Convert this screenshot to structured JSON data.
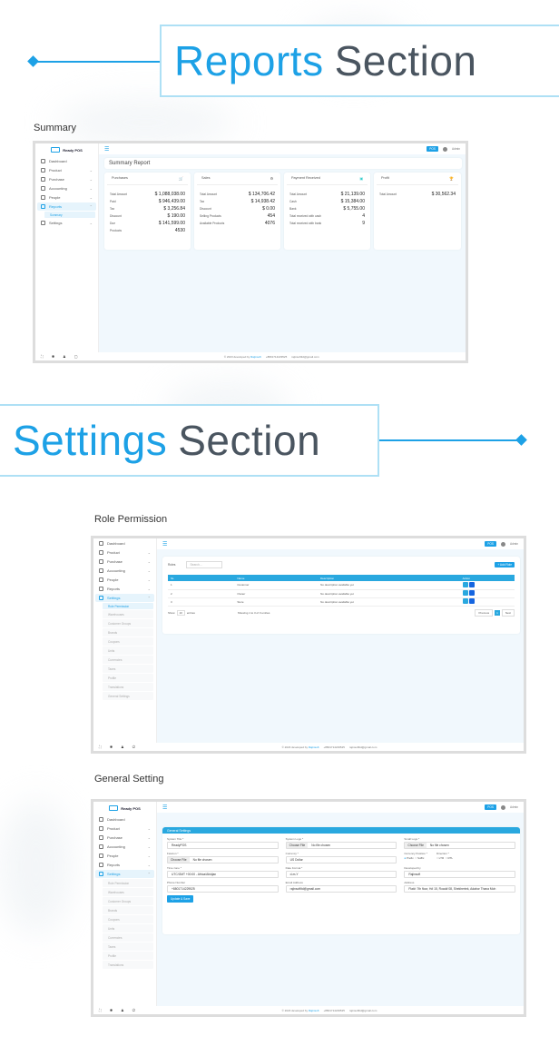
{
  "reports_header": {
    "highlight": "Reports",
    "rest": "Section"
  },
  "settings_header": {
    "highlight": "Settings",
    "rest": "Section"
  },
  "captions": {
    "summary": "Summary",
    "role": "Role Permission",
    "general": "General Setting"
  },
  "app": {
    "brand": "Ready POS",
    "pos_button": "POS",
    "admin": "Admin",
    "footer": {
      "copyright": "© 2023 developed by",
      "company": "Rajinsoft",
      "phone": "+8801714229525",
      "email": "rajinsoftltd@gmail.com"
    },
    "nav": [
      "Dashboard",
      "Product",
      "Purchase",
      "Accounting",
      "People",
      "Reports",
      "Settings"
    ],
    "reports_sub": [
      "Summary"
    ],
    "settings_sub": [
      "Role Permission",
      "Warehouses",
      "Customer Groups",
      "Brands",
      "Coupons",
      "Units",
      "Currencies",
      "Taxes",
      "Profile",
      "Translations",
      "General Settings"
    ]
  },
  "summary": {
    "title": "Summary Report",
    "purchases": {
      "title": "Purchases",
      "rows": [
        [
          "Total Amount",
          "$ 1,088,038.00"
        ],
        [
          "Paid",
          "$ 946,439.00"
        ],
        [
          "Tax",
          "$ 3,256.84"
        ],
        [
          "Discount",
          "$ 190.00"
        ],
        [
          "Due",
          "$ 141,599.00"
        ],
        [
          "Products",
          "4530"
        ]
      ]
    },
    "sales": {
      "title": "Sales",
      "rows": [
        [
          "Total Amount",
          "$ 134,706.42"
        ],
        [
          "Tax",
          "$ 14,938.42"
        ],
        [
          "Discount",
          "$ 0.00"
        ],
        [
          "Selling Products",
          "454"
        ],
        [
          "Available Products",
          "4076"
        ]
      ]
    },
    "payment": {
      "title": "Payment Received",
      "rows": [
        [
          "Total Amount",
          "$ 21,139.00"
        ],
        [
          "Cash",
          "$ 15,384.00"
        ],
        [
          "Bank",
          "$ 5,755.00"
        ],
        [
          "Total received with cash",
          "4"
        ],
        [
          "Total received with bank",
          "9"
        ]
      ]
    },
    "profit": {
      "title": "Profit",
      "rows": [
        [
          "Total Amount",
          "$ 30,562.34"
        ]
      ]
    }
  },
  "roles": {
    "label": "Roles",
    "search_placeholder": "Search...",
    "add_button": "+ Add Role",
    "columns": [
      "SL",
      "Name",
      "Description",
      "Action"
    ],
    "rows": [
      [
        "1",
        "Customer",
        "No description available yet"
      ],
      [
        "2",
        "Owner",
        "No description available yet"
      ],
      [
        "3",
        "Store",
        "No description available yet"
      ]
    ],
    "show": "Show",
    "entries_value": "10",
    "entries": "entries",
    "showing": "Showing 1 to 3 of 3 entries",
    "prev": "Previous",
    "page": "1",
    "next": "Next"
  },
  "general": {
    "title": "General Settings",
    "system_title": {
      "label": "System Title *",
      "value": "ReadyPOS"
    },
    "system_logo": {
      "label": "System Logo *",
      "button": "Choose File",
      "value": "No file chosen"
    },
    "small_logo": {
      "label": "Small Logo *",
      "button": "Choose File",
      "value": "No file chosen"
    },
    "favicon": {
      "label": "Favicon *",
      "button": "Choose File",
      "value": "No file chosen"
    },
    "currency": {
      "label": "Currency *",
      "value": "US Dollar"
    },
    "currency_position": {
      "label": "Currency Position *",
      "options": [
        "Prefix",
        "Suffix"
      ],
      "selected": "Prefix"
    },
    "direction": {
      "label": "Direction *",
      "options": [
        "LTR",
        "RTL"
      ]
    },
    "timezone": {
      "label": "Time zone *",
      "value": "UTC/GMT +00:00 - Africa/Abidjan"
    },
    "date_format": {
      "label": "Date Format *",
      "value": "d-m-Y"
    },
    "developed_by": {
      "label": "Developed by",
      "value": "Rajinsoft"
    },
    "phone": {
      "label": "Phone Number",
      "value": "+8801714229525"
    },
    "email": {
      "label": "Email Address",
      "value": "rajinsoftltd@gmail.com"
    },
    "address": {
      "label": "Address",
      "value": "Flat#: 7th floor, H# 15, Road# 08, Shekhertek, Adabor Thana Moh"
    },
    "save": "Update & Save"
  }
}
